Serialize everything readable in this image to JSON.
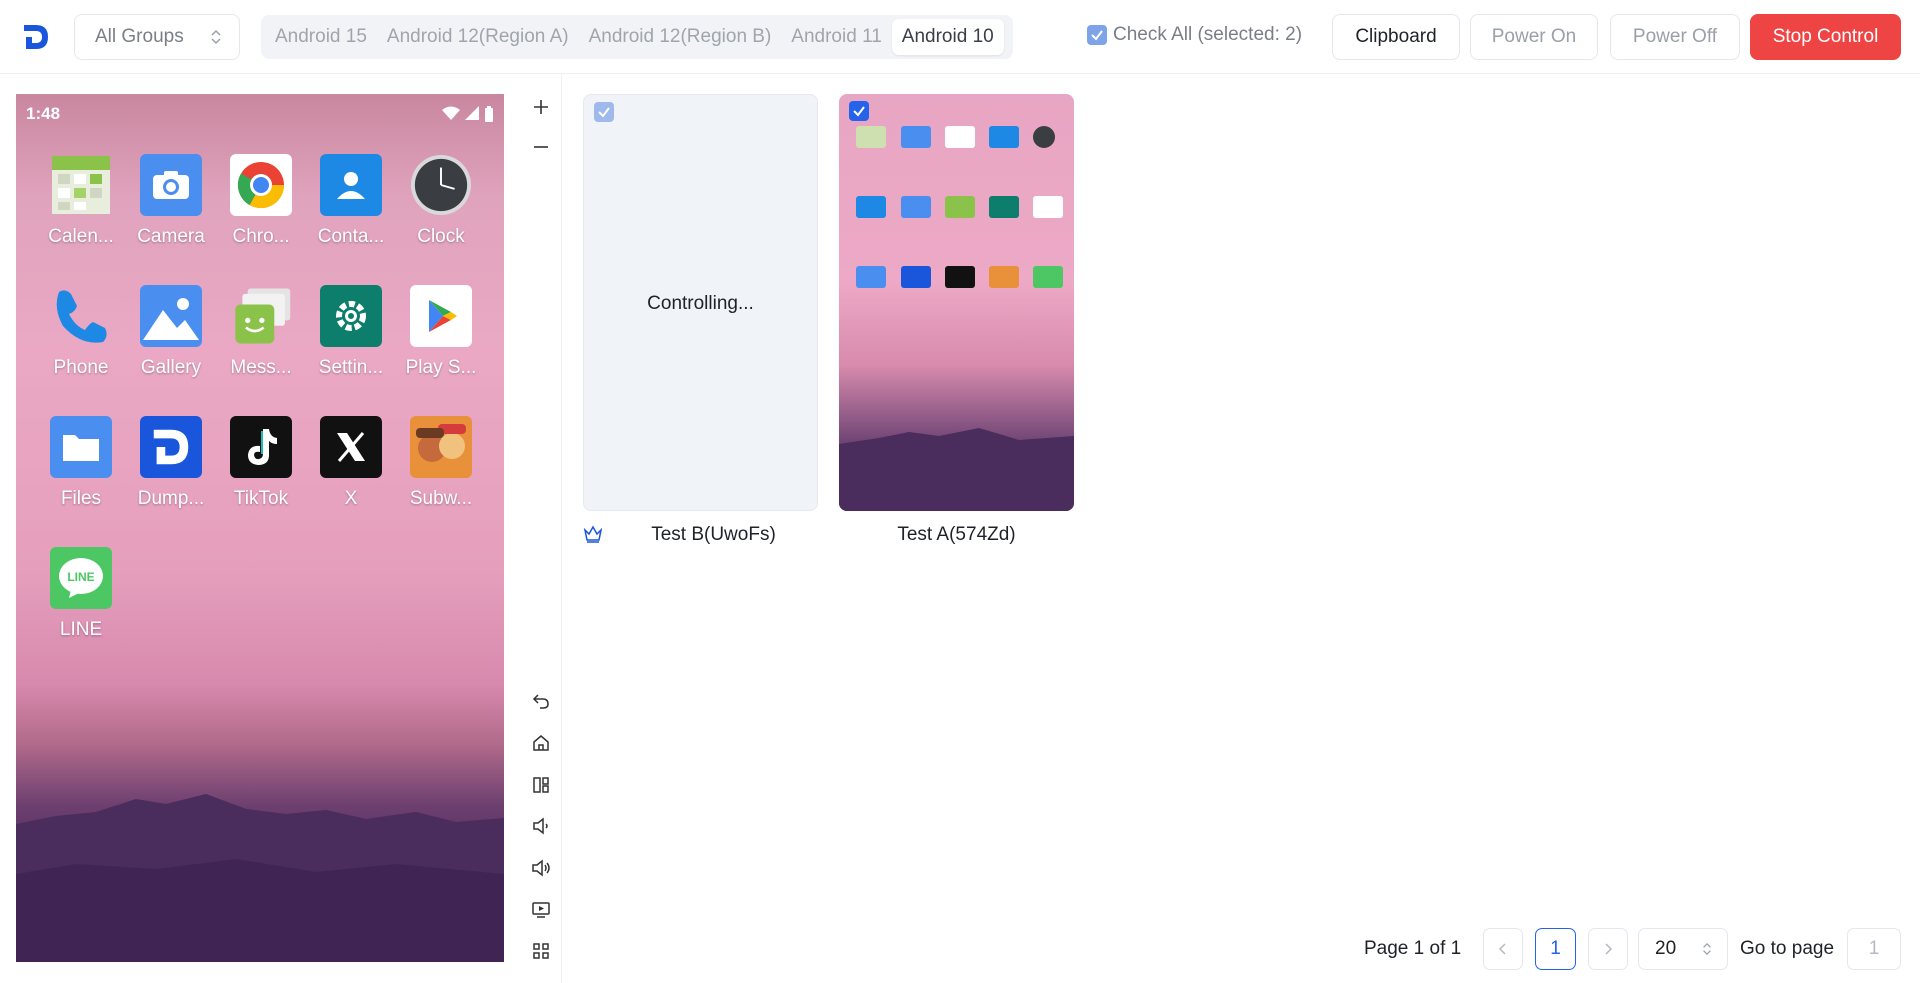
{
  "header": {
    "group_select": "All Groups",
    "tabs": [
      {
        "label": "Android 15",
        "active": false
      },
      {
        "label": "Android 12(Region A)",
        "active": false
      },
      {
        "label": "Android 12(Region B)",
        "active": false
      },
      {
        "label": "Android 11",
        "active": false
      },
      {
        "label": "Android 10",
        "active": true
      }
    ],
    "check_all": "Check All (selected: 2)",
    "clipboard": "Clipboard",
    "power_on": "Power On",
    "power_off": "Power Off",
    "stop_control": "Stop Control"
  },
  "phone": {
    "time": "1:48",
    "apps": [
      {
        "label": "Calen...",
        "icon": "calendar-icon"
      },
      {
        "label": "Camera",
        "icon": "camera-icon"
      },
      {
        "label": "Chro...",
        "icon": "chrome-icon"
      },
      {
        "label": "Conta...",
        "icon": "contacts-icon"
      },
      {
        "label": "Clock",
        "icon": "clock-icon"
      },
      {
        "label": "Phone",
        "icon": "phone-icon"
      },
      {
        "label": "Gallery",
        "icon": "gallery-icon"
      },
      {
        "label": "Mess...",
        "icon": "messages-icon"
      },
      {
        "label": "Settin...",
        "icon": "settings-icon"
      },
      {
        "label": "Play S...",
        "icon": "play-store-icon"
      },
      {
        "label": "Files",
        "icon": "files-icon"
      },
      {
        "label": "Dump...",
        "icon": "dump-icon"
      },
      {
        "label": "TikTok",
        "icon": "tiktok-icon"
      },
      {
        "label": "X",
        "icon": "x-icon"
      },
      {
        "label": "Subw...",
        "icon": "subway-icon"
      },
      {
        "label": "LINE",
        "icon": "line-icon"
      }
    ]
  },
  "devices": [
    {
      "name": "Test B(UwoFs)",
      "status": "Controlling...",
      "checked": true,
      "master": true
    },
    {
      "name": "Test A(574Zd)",
      "status": "",
      "checked": true,
      "master": false
    }
  ],
  "pagination": {
    "summary": "Page 1 of 1",
    "current": "1",
    "page_size": "20",
    "goto_label": "Go to page",
    "goto_value": "1"
  },
  "colors": {
    "accent": "#2563eb",
    "stop": "#ef4444"
  }
}
